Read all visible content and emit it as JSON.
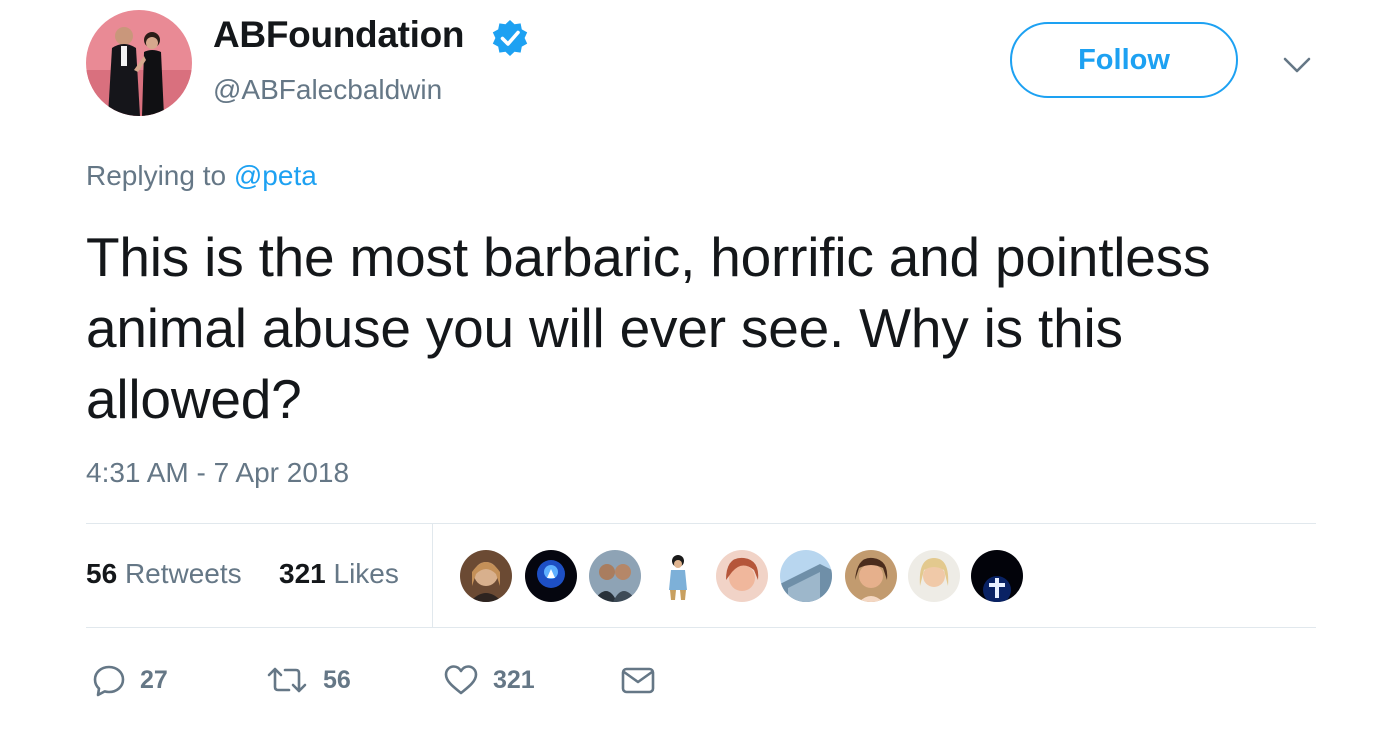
{
  "author": {
    "display_name": "ABFoundation",
    "handle": "@ABFalecbaldwin",
    "verified": true,
    "avatar_icon": "profile-photo-couple"
  },
  "header": {
    "follow_label": "Follow",
    "menu_icon": "chevron-down-icon"
  },
  "reply": {
    "prefix": "Replying to",
    "mention": "@peta"
  },
  "tweet": {
    "text": "This is the most barbaric, horrific and pointless animal abuse you will ever see. Why is this allowed?",
    "timestamp": "4:31 AM - 7 Apr 2018"
  },
  "stats": {
    "retweets_count": "56",
    "retweets_label": "Retweets",
    "likes_count": "321",
    "likes_label": "Likes"
  },
  "likers_icon": "liker-avatar-icon",
  "actions": {
    "reply_count": "27",
    "retweet_count": "56",
    "like_count": "321"
  },
  "colors": {
    "accent": "#1da1f2",
    "text": "#14171a",
    "muted": "#657786",
    "divider": "#e1e8ed"
  }
}
